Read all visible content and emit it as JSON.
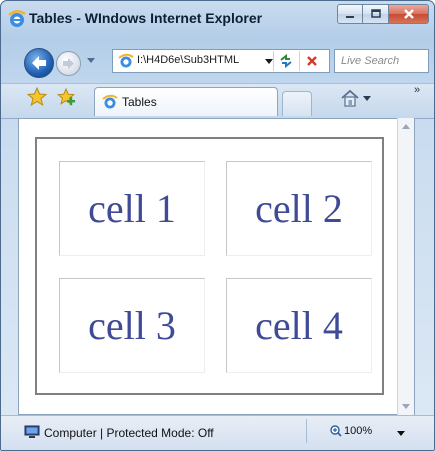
{
  "window": {
    "title": "Tables - WIndows Internet Explorer",
    "title_icon": "ie-logo-icon",
    "controls": [
      "minimize-icon",
      "maximize-icon",
      "close-icon"
    ]
  },
  "navigation": {
    "address_value": "I:\\H4D6e\\Sub3HTML",
    "search_placeholder": "Live Search"
  },
  "tabs": {
    "active_tab_label": "Tables"
  },
  "page": {
    "cells": [
      "cell 1",
      "cell 2",
      "cell 3",
      "cell 4"
    ]
  },
  "status": {
    "zone_text": "Computer | Protected Mode: Off",
    "zoom_level": "100%"
  },
  "colors": {
    "cell_text": "#3f4b96",
    "close_button": "#c74b32"
  }
}
